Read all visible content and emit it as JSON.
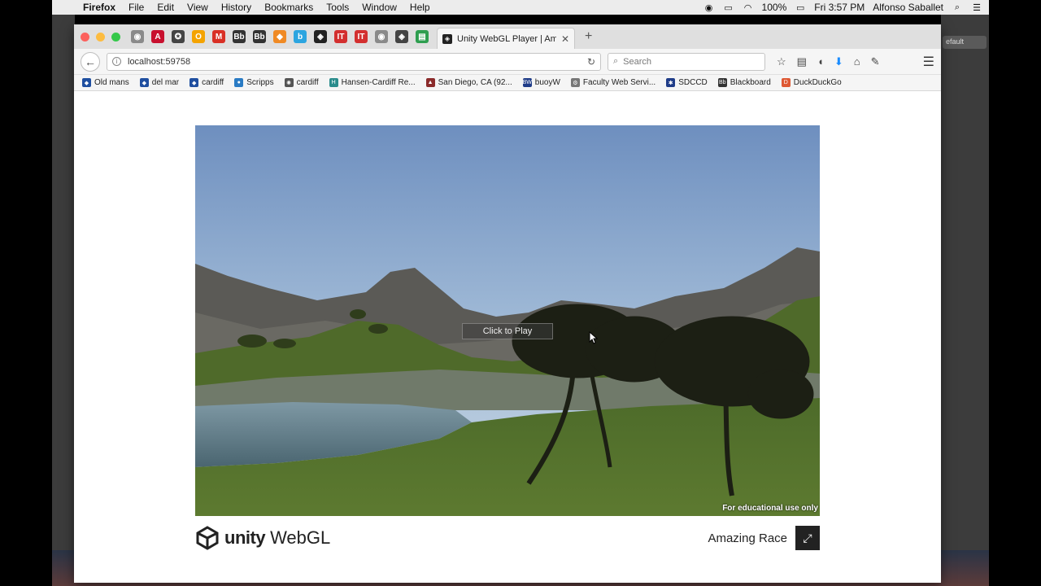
{
  "menubar": {
    "app": "Firefox",
    "menus": [
      "File",
      "Edit",
      "View",
      "History",
      "Bookmarks",
      "Tools",
      "Window",
      "Help"
    ],
    "battery": "100%",
    "clock": "Fri 3:57 PM",
    "user": "Alfonso Saballet"
  },
  "editor": {
    "right_button": "efault"
  },
  "browser": {
    "active_tab_title": "Unity WebGL Player | Amaz...",
    "url": "localhost:59758",
    "search_placeholder": "Search",
    "pinned_tabs": [
      {
        "icon": "globe-icon",
        "color": "#8a8a8a",
        "glyph": "◉"
      },
      {
        "icon": "red-a-icon",
        "color": "#c8102e",
        "glyph": "A"
      },
      {
        "icon": "swirl-icon",
        "color": "#444",
        "glyph": "✪"
      },
      {
        "icon": "orange-o-icon",
        "color": "#f4a300",
        "glyph": "O"
      },
      {
        "icon": "gmail-icon",
        "color": "#d93025",
        "glyph": "M"
      },
      {
        "icon": "bb-icon",
        "color": "#333",
        "glyph": "Bb"
      },
      {
        "icon": "bb2-icon",
        "color": "#333",
        "glyph": "Bb"
      },
      {
        "icon": "bag-icon",
        "color": "#f08a24",
        "glyph": "◆"
      },
      {
        "icon": "b-icon",
        "color": "#2ca5e0",
        "glyph": "b"
      },
      {
        "icon": "unity-icon",
        "color": "#222",
        "glyph": "◈"
      },
      {
        "icon": "it-icon",
        "color": "#d32f2f",
        "glyph": "IT"
      },
      {
        "icon": "it2-icon",
        "color": "#d32f2f",
        "glyph": "IT"
      },
      {
        "icon": "globe2-icon",
        "color": "#8a8a8a",
        "glyph": "◉"
      },
      {
        "icon": "unity2-icon",
        "color": "#444",
        "glyph": "◈"
      },
      {
        "icon": "sheet-icon",
        "color": "#2e9e4f",
        "glyph": "▤"
      }
    ],
    "bookmarks": [
      {
        "label": "Old mans",
        "color": "#1f4fa0",
        "glyph": "◆"
      },
      {
        "label": "del mar",
        "color": "#1f4fa0",
        "glyph": "◆"
      },
      {
        "label": "cardiff",
        "color": "#1f4fa0",
        "glyph": "◆"
      },
      {
        "label": "Scripps",
        "color": "#2a7bc4",
        "glyph": "●"
      },
      {
        "label": "cardiff",
        "color": "#555",
        "glyph": "✺"
      },
      {
        "label": "Hansen-Cardiff Re...",
        "color": "#2a8c8c",
        "glyph": "H"
      },
      {
        "label": "San Diego, CA (92...",
        "color": "#8b2b2b",
        "glyph": "▲"
      },
      {
        "label": "buoyW",
        "color": "#1f3c88",
        "glyph": "BW"
      },
      {
        "label": "Faculty Web Servi...",
        "color": "#777",
        "glyph": "⚙"
      },
      {
        "label": "SDCCD",
        "color": "#1f3c88",
        "glyph": "✱"
      },
      {
        "label": "Blackboard",
        "color": "#333",
        "glyph": "Bb"
      },
      {
        "label": "DuckDuckGo",
        "color": "#de5833",
        "glyph": "D"
      }
    ]
  },
  "game": {
    "click_to_play": "Click to Play",
    "watermark": "For educational use only"
  },
  "footer": {
    "unity_word": "unity",
    "webgl_word": "WebGL",
    "title": "Amazing Race",
    "fullscreen_glyph": "⤢"
  }
}
